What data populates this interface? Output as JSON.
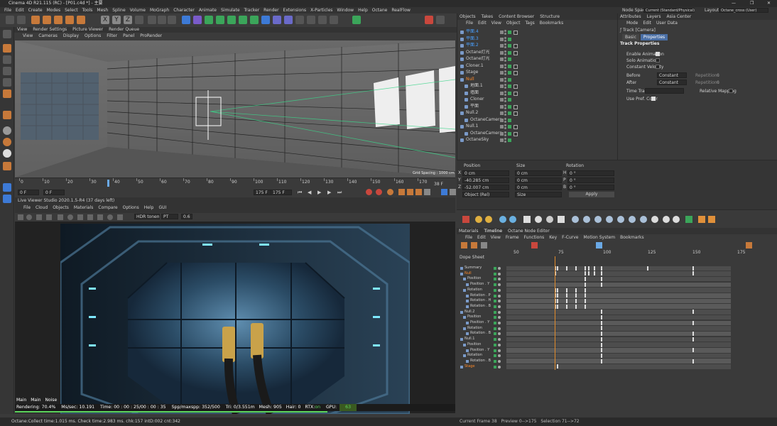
{
  "window": {
    "title": "Cinema 4D R21.115 (RC) - [P01.c4d *] - 主要"
  },
  "menu": [
    "File",
    "Edit",
    "Create",
    "Modes",
    "Select",
    "Tools",
    "Mesh",
    "Spline",
    "Volume",
    "MoGraph",
    "Character",
    "Animate",
    "Simulate",
    "Tracker",
    "Render",
    "Extensions",
    "X-Particles",
    "Window",
    "Help",
    "Octane",
    "RealFlow"
  ],
  "nodespace": {
    "label": "Node Space:",
    "value": "Current (Standard/Physical)"
  },
  "layout": {
    "label": "Layout:",
    "value": "Octane_cross (User)"
  },
  "viewport_tabs": [
    "View",
    "Render Settings",
    "Picture Viewer",
    "Render Queue"
  ],
  "viewport_menu": [
    "View",
    "Cameras",
    "Display",
    "Options",
    "Filter",
    "Panel",
    "ProRender"
  ],
  "viewport": {
    "grid_spacing": "Grid Spacing : 1000 cm"
  },
  "ruler": {
    "ticks": [
      "0",
      "10",
      "20",
      "30",
      "40",
      "50",
      "60",
      "70",
      "80",
      "90",
      "100",
      "110",
      "120",
      "130",
      "140",
      "150",
      "160",
      "170"
    ],
    "end_label": "38 F"
  },
  "transport": {
    "start": "0 F",
    "current": "0 F",
    "end": "175 F",
    "end2": "175 F"
  },
  "liveviewer": {
    "title": "Live Viewer Studio 2020.1.5-R4 (37 days left)",
    "menu": [
      "File",
      "Cloud",
      "Objects",
      "Materials",
      "Compare",
      "Options",
      "Help",
      "GUI"
    ],
    "tonemap": "HDR tonem",
    "mode": "PT",
    "zoom": "0.6",
    "channels": [
      "Main",
      "Main",
      "Noise"
    ],
    "stats": {
      "rendering": "Rendering: 70.4%",
      "ms_sec": "Ms/sec: 10.191",
      "time": "Time: 00 : 00 : 25/00 : 00 : 35",
      "spp": "Spp/maxspp: 352/500",
      "tri": "Tri: 0/3.551m",
      "mesh": "Mesh: 905",
      "hair": "Hair: 0",
      "rtx": "RTX:",
      "rtx_val": "on",
      "gpu": "GPU:",
      "gpu_val": "63"
    }
  },
  "status": "Octane:Collect time:1.015 ms.  Check time:2.983 ms.  chk:157 intD:002 cnt:342",
  "objects": {
    "tabs": [
      "Objects",
      "Takes",
      "Content Browser",
      "Structure"
    ],
    "menu": [
      "File",
      "Edit",
      "View",
      "Object",
      "Tags",
      "Bookmarks"
    ],
    "rows": [
      {
        "name": "平面.4",
        "color": "#4aa0ff"
      },
      {
        "name": "平面.3",
        "color": "#4aa0ff"
      },
      {
        "name": "平面.2",
        "color": "#4aa0ff"
      },
      {
        "name": "Octane灯光",
        "color": "#cfcfcf"
      },
      {
        "name": "Octane灯光",
        "color": "#cfcfcf"
      },
      {
        "name": "Cloner.1",
        "color": "#cfcfcf"
      },
      {
        "name": "Stage",
        "color": "#cfcfcf"
      },
      {
        "name": "Null",
        "color": "#ff8a2a"
      },
      {
        "name": "地面.1",
        "color": "#cfcfcf"
      },
      {
        "name": "墙面",
        "color": "#cfcfcf"
      },
      {
        "name": "Cloner",
        "color": "#cfcfcf"
      },
      {
        "name": "平面",
        "color": "#cfcfcf"
      },
      {
        "name": "Null.2",
        "color": "#cfcfcf"
      },
      {
        "name": "OctaneCamera",
        "color": "#cfcfcf"
      },
      {
        "name": "Null.1",
        "color": "#cfcfcf"
      },
      {
        "name": "OctaneCamera",
        "color": "#cfcfcf"
      },
      {
        "name": "OctaneSky",
        "color": "#cfcfcf"
      }
    ]
  },
  "attributes": {
    "tabs": [
      "Attributes",
      "Layers",
      "Asia Center"
    ],
    "menu": [
      "Mode",
      "Edit",
      "User Data"
    ],
    "object": "Track [Camera]",
    "subtabs": [
      "Basic",
      "Properties"
    ],
    "section": "Track Properties",
    "fields": {
      "enable_animation": "Enable Animation",
      "solo_animation": "Solo Animation",
      "constant_velocity": "Constant Velocity",
      "before": "Before",
      "before_value": "Constant",
      "after": "After",
      "after_value": "Constant",
      "repetitions": "Repetitions",
      "rep_value": "0",
      "time_track": "Time Track",
      "relative_mapping": "Relative Mapping",
      "use_pref_color": "Use Pref. Color"
    }
  },
  "coords": {
    "headers": [
      "Position",
      "Size",
      "Rotation"
    ],
    "rows": [
      {
        "axis": "X",
        "pos": "0 cm",
        "size": "0 cm",
        "rot_axis": "H",
        "rot": "0 °"
      },
      {
        "axis": "Y",
        "pos": "-40.285 cm",
        "size": "0 cm",
        "rot_axis": "P",
        "rot": "0 °"
      },
      {
        "axis": "Z",
        "pos": "-52.007 cm",
        "size": "0 cm",
        "rot_axis": "B",
        "rot": "0 °"
      }
    ],
    "mode": "Object (Rel)",
    "size_mode": "Size",
    "apply": "Apply"
  },
  "timeline": {
    "tabs": [
      "Materials",
      "Timeline",
      "Octane Node Editor"
    ],
    "menu": [
      "File",
      "Edit",
      "View",
      "Frame",
      "Functions",
      "Key",
      "F-Curve",
      "Motion System",
      "Bookmarks"
    ],
    "mode": "Dope Sheet",
    "ruler": [
      "50",
      "75",
      "100",
      "125",
      "150",
      "175"
    ],
    "tracks": [
      {
        "name": "Summary",
        "indent": 0,
        "color": "#cfcfcf"
      },
      {
        "name": "Null",
        "indent": 0,
        "color": "#ff8a2a"
      },
      {
        "name": "Position",
        "indent": 1,
        "color": "#cfcfcf"
      },
      {
        "name": "Position . Y",
        "indent": 2,
        "color": "#cfcfcf"
      },
      {
        "name": "Rotation",
        "indent": 1,
        "color": "#cfcfcf"
      },
      {
        "name": "Rotation . P",
        "indent": 2,
        "color": "#cfcfcf"
      },
      {
        "name": "Rotation . H",
        "indent": 2,
        "color": "#cfcfcf"
      },
      {
        "name": "Rotation . B",
        "indent": 2,
        "color": "#cfcfcf"
      },
      {
        "name": "Null.2",
        "indent": 0,
        "color": "#cfcfcf"
      },
      {
        "name": "Position",
        "indent": 1,
        "color": "#cfcfcf"
      },
      {
        "name": "Position . Y",
        "indent": 2,
        "color": "#cfcfcf"
      },
      {
        "name": "Rotation",
        "indent": 1,
        "color": "#cfcfcf"
      },
      {
        "name": "Rotation . B",
        "indent": 2,
        "color": "#cfcfcf"
      },
      {
        "name": "Null.1",
        "indent": 0,
        "color": "#cfcfcf"
      },
      {
        "name": "Position",
        "indent": 1,
        "color": "#cfcfcf"
      },
      {
        "name": "Position . Y",
        "indent": 2,
        "color": "#cfcfcf"
      },
      {
        "name": "Rotation",
        "indent": 1,
        "color": "#cfcfcf"
      },
      {
        "name": "Rotation . B",
        "indent": 2,
        "color": "#cfcfcf"
      },
      {
        "name": "Stage",
        "indent": 0,
        "color": "#ff8a2a"
      }
    ],
    "status": {
      "current_frame": "Current Frame  38",
      "preview": "Preview  0-->175",
      "selection": "Selection  71-->72"
    }
  }
}
